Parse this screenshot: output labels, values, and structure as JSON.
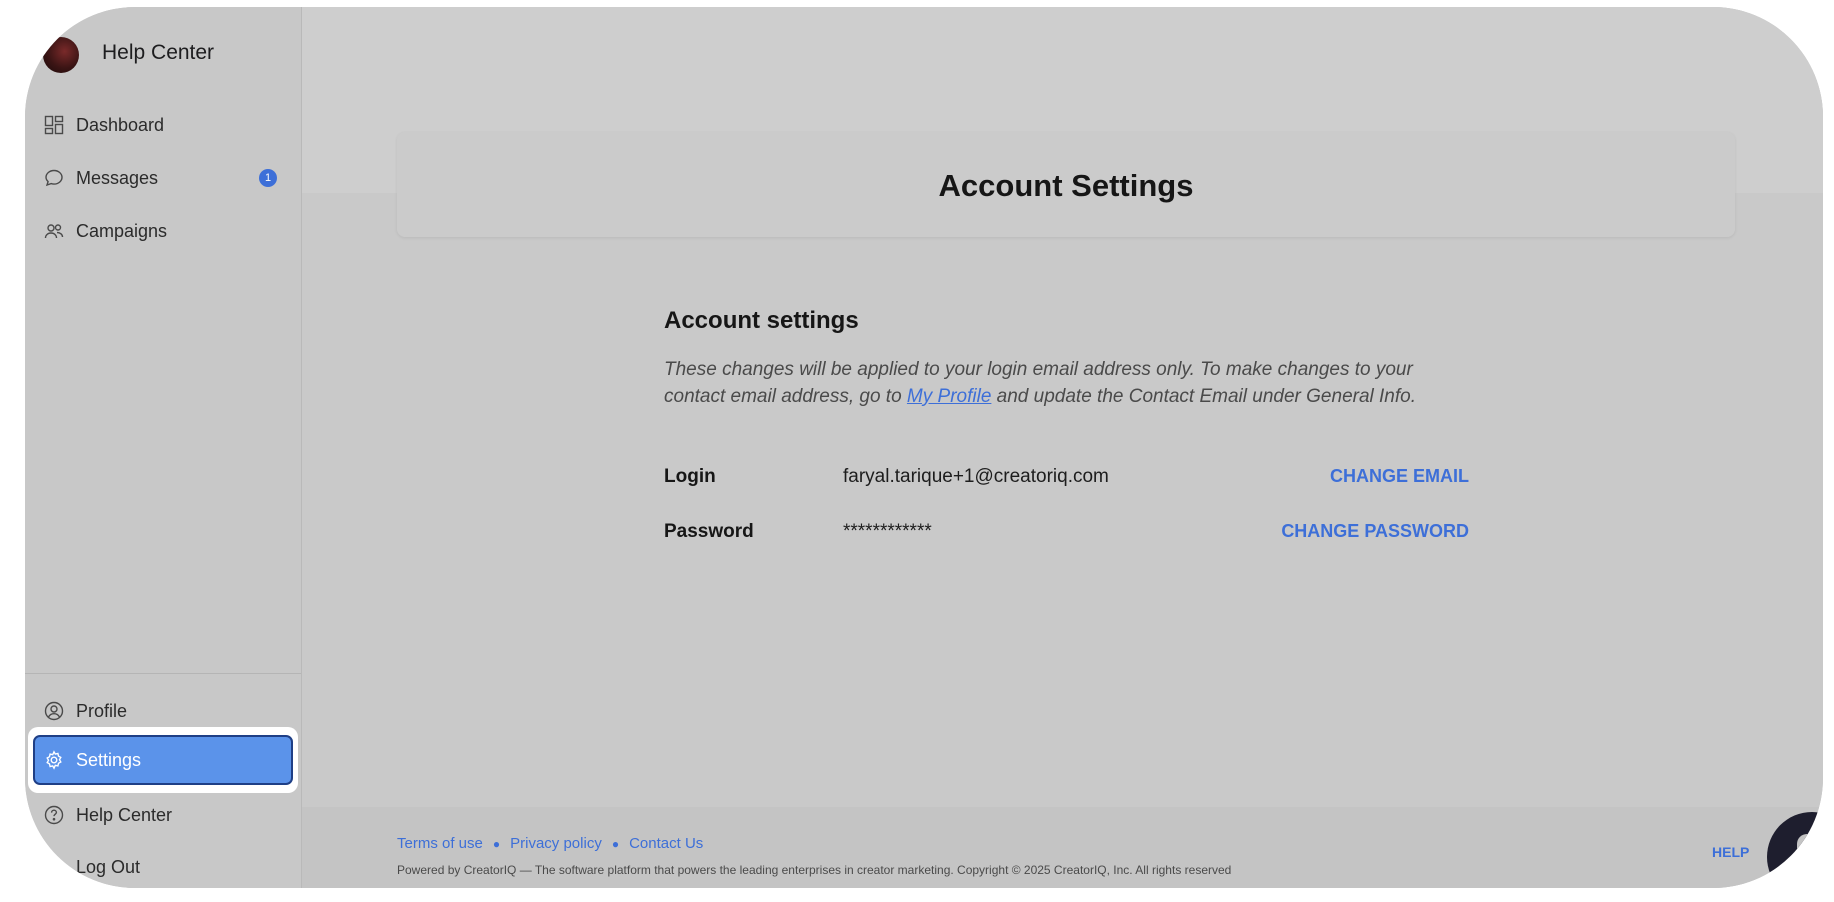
{
  "sidebar": {
    "brand_title": "Help Center",
    "nav": [
      {
        "label": "Dashboard",
        "icon": "dashboard-icon"
      },
      {
        "label": "Messages",
        "icon": "message-icon",
        "badge": "1"
      },
      {
        "label": "Campaigns",
        "icon": "users-icon"
      }
    ],
    "bottom_nav": [
      {
        "label": "Profile",
        "icon": "user-circle-icon"
      },
      {
        "label": "Settings",
        "icon": "gear-icon",
        "active": true
      },
      {
        "label": "Help Center",
        "icon": "help-circle-icon"
      },
      {
        "label": "Log Out",
        "icon": "logout-icon"
      }
    ]
  },
  "header": {
    "title": "Account Settings"
  },
  "account": {
    "section_title": "Account settings",
    "desc_before": "These changes will be applied to your login email address only. To make changes to your contact email address, go to ",
    "desc_link": "My Profile",
    "desc_after": " and update the Contact Email under General Info.",
    "rows": [
      {
        "label": "Login",
        "value": "faryal.tarique+1@creatoriq.com",
        "action": "CHANGE EMAIL"
      },
      {
        "label": "Password",
        "value": "************",
        "action": "CHANGE PASSWORD"
      }
    ]
  },
  "footer": {
    "links": [
      "Terms of use",
      "Privacy policy",
      "Contact Us"
    ],
    "copyright": "Powered by CreatorIQ — The software platform that powers the leading enterprises in creator marketing. Copyright © 2025 CreatorIQ, Inc. All rights reserved",
    "help_label": "HELP"
  },
  "colors": {
    "accent": "#3d6fd8",
    "active_nav": "#5b93ea",
    "overlay_bg": "#c9c9c9"
  }
}
